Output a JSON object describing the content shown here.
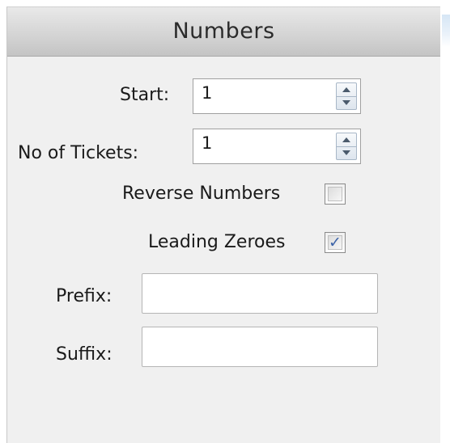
{
  "panel": {
    "title": "Numbers"
  },
  "fields": {
    "start": {
      "label": "Start:",
      "value": "1"
    },
    "no_of_tickets": {
      "label": "No of Tickets:",
      "value": "1"
    },
    "reverse_numbers": {
      "label": "Reverse Numbers",
      "checked": false
    },
    "leading_zeroes": {
      "label": "Leading Zeroes",
      "checked": true,
      "check_glyph": "✓"
    },
    "prefix": {
      "label": "Prefix:",
      "value": ""
    },
    "suffix": {
      "label": "Suffix:",
      "value": ""
    }
  },
  "colors": {
    "panel_background": "#f0f0f0",
    "check_mark": "#3c63a8",
    "spin_arrow_border": "#a8b7c7"
  },
  "icons": {
    "spin_up": "triangle-up-icon",
    "spin_down": "triangle-down-icon",
    "check": "check-icon"
  }
}
